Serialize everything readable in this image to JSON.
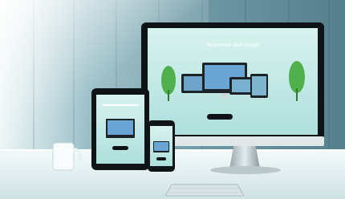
{
  "photo": {
    "screen_headline": "Responsive Web Design",
    "colors": {
      "wall_light": "#dcecef",
      "wall_mid": "#9cc2cb",
      "wall_dark": "#4f7a86",
      "desk": "#eef6f7",
      "screen_bg": "#bfe7e4",
      "device_black": "#0f1416",
      "accent_green": "#4fb04c"
    }
  }
}
